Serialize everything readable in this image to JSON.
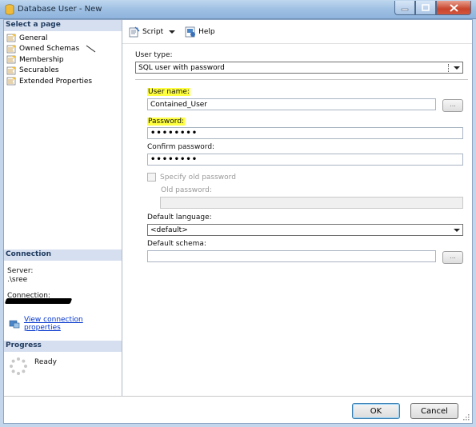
{
  "window": {
    "title": "Database User - New"
  },
  "left": {
    "select_header": "Select a page",
    "pages": [
      "General",
      "Owned Schemas",
      "Membership",
      "Securables",
      "Extended Properties"
    ],
    "connection_header": "Connection",
    "server_label": "Server:",
    "server_value": ".\\sree",
    "connection_label": "Connection:",
    "view_props": "View connection properties",
    "progress_header": "Progress",
    "progress_status": "Ready"
  },
  "toolbar": {
    "script": "Script",
    "help": "Help"
  },
  "form": {
    "user_type_label": "User type:",
    "user_type_value": "SQL user with password",
    "user_name_label": "User name:",
    "user_name_value": "Contained_User",
    "password_label": "Password:",
    "password_value": "••••••••",
    "confirm_label": "Confirm password:",
    "confirm_value": "••••••••",
    "specify_old_label": "Specify old password",
    "old_password_label": "Old password:",
    "default_language_label": "Default language:",
    "default_language_value": "<default>",
    "default_schema_label": "Default schema:",
    "default_schema_value": "",
    "ellipsis": "..."
  },
  "buttons": {
    "ok": "OK",
    "cancel": "Cancel"
  },
  "colors": {
    "highlight": "#ffff40",
    "link": "#0033cc",
    "section_header": "#d5dfef"
  }
}
